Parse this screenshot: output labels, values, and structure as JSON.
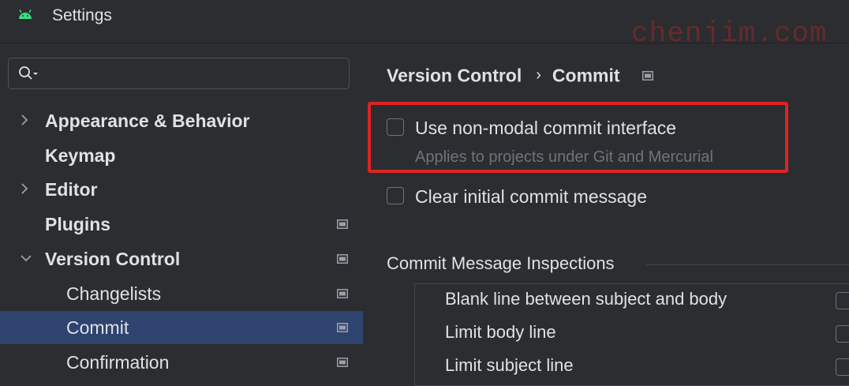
{
  "window": {
    "title": "Settings",
    "watermark": "chenjim.com"
  },
  "sidebar": {
    "search": {
      "placeholder": "",
      "value": ""
    },
    "items": [
      {
        "label": "Appearance & Behavior",
        "level": 0,
        "expandable": true,
        "expanded": false,
        "project_icon": false,
        "selected": false
      },
      {
        "label": "Keymap",
        "level": 0,
        "expandable": false,
        "project_icon": false,
        "selected": false
      },
      {
        "label": "Editor",
        "level": 0,
        "expandable": true,
        "expanded": false,
        "project_icon": false,
        "selected": false
      },
      {
        "label": "Plugins",
        "level": 0,
        "expandable": false,
        "project_icon": true,
        "selected": false
      },
      {
        "label": "Version Control",
        "level": 0,
        "expandable": true,
        "expanded": true,
        "project_icon": true,
        "selected": false
      },
      {
        "label": "Changelists",
        "level": 1,
        "expandable": false,
        "project_icon": true,
        "selected": false
      },
      {
        "label": "Commit",
        "level": 1,
        "expandable": false,
        "project_icon": true,
        "selected": true
      },
      {
        "label": "Confirmation",
        "level": 1,
        "expandable": false,
        "project_icon": true,
        "selected": false
      }
    ]
  },
  "main": {
    "breadcrumb": {
      "parent": "Version Control",
      "separator": "›",
      "current": "Commit"
    },
    "options": [
      {
        "label": "Use non-modal commit interface",
        "hint": "Applies to projects under Git and Mercurial",
        "checked": false,
        "highlighted": true
      },
      {
        "label": "Clear initial commit message",
        "checked": false
      }
    ],
    "inspections": {
      "title": "Commit Message Inspections",
      "rows": [
        {
          "label": "Blank line between subject and body",
          "checked": false
        },
        {
          "label": "Limit body line",
          "checked": false
        },
        {
          "label": "Limit subject line",
          "checked": false
        }
      ]
    }
  },
  "colors": {
    "background": "#2b2d30",
    "selection": "#2e436e",
    "highlight_box": "#e02222",
    "android_green": "#3ddc84",
    "hint_text": "#6f737a"
  }
}
